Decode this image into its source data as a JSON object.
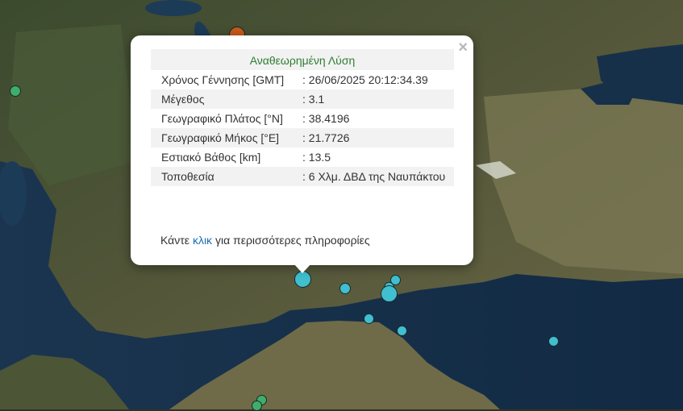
{
  "map": {
    "colors": {
      "land_dark": "#3a4a30",
      "land_light": "#8a8a62",
      "sea": "#16304a",
      "marker_green": "#3fae6a",
      "marker_cyan": "#3fbfcf",
      "marker_orange": "#c85a1a"
    },
    "markers": [
      {
        "color": "green",
        "icon": "earthquake-marker-icon"
      },
      {
        "color": "orange",
        "icon": "earthquake-marker-icon"
      },
      {
        "color": "cyan",
        "icon": "earthquake-marker-icon"
      },
      {
        "color": "cyan",
        "icon": "earthquake-marker-icon"
      },
      {
        "color": "cyan",
        "icon": "earthquake-marker-icon"
      },
      {
        "color": "cyan",
        "icon": "earthquake-marker-icon"
      },
      {
        "color": "cyan",
        "icon": "earthquake-marker-icon"
      },
      {
        "color": "cyan",
        "icon": "earthquake-marker-icon"
      },
      {
        "color": "cyan",
        "icon": "earthquake-marker-icon"
      },
      {
        "color": "cyan",
        "icon": "earthquake-marker-icon"
      },
      {
        "color": "green",
        "icon": "earthquake-marker-icon"
      },
      {
        "color": "green",
        "icon": "earthquake-marker-icon"
      }
    ]
  },
  "popup": {
    "close_label": "×",
    "title": "Αναθεωρημένη Λύση",
    "rows": [
      {
        "label": "Χρόνος Γέννησης [GMT]",
        "value": ": 26/06/2025 20:12:34.39"
      },
      {
        "label": "Μέγεθος",
        "value": ": 3.1"
      },
      {
        "label": "Γεωγραφικό Πλάτος [°N]",
        "value": ": 38.4196"
      },
      {
        "label": "Γεωγραφικό Μήκος [°E]",
        "value": ": 21.7726"
      },
      {
        "label": "Εστιακό Βάθος [km]",
        "value": ": 13.5"
      },
      {
        "label": "Τοποθεσία",
        "value": ": 6 Χλμ. ΔΒΔ της Ναυπάκτου"
      }
    ],
    "more_prefix": "Κάντε",
    "more_link": "κλικ",
    "more_suffix": "για περισσότερες πληροφορίες"
  }
}
